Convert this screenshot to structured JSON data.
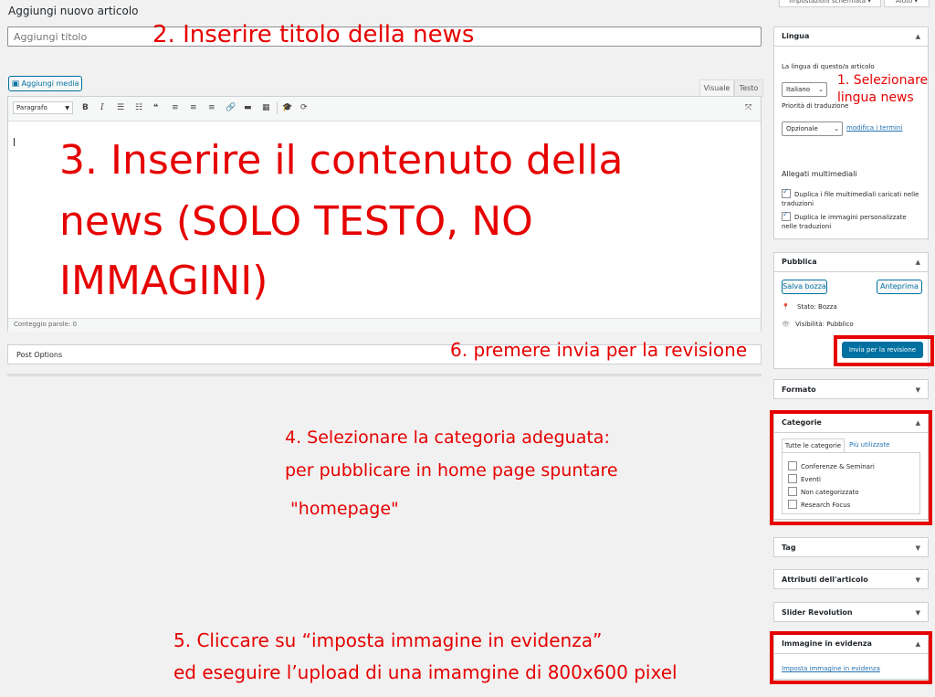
{
  "page": {
    "title": "Aggiungi nuovo articolo",
    "top_buttons": [
      "Impostazioni schermata ▾",
      "Aiuto ▾"
    ]
  },
  "title_input": {
    "placeholder": "Aggiungi titolo"
  },
  "editor": {
    "add_media_label": "Aggiungi media",
    "tabs": [
      "Visuale",
      "Testo"
    ],
    "format_select": "Paragrafo",
    "toolbar_icons": [
      "bold-icon",
      "italic-icon",
      "bullet-list-icon",
      "numbered-list-icon",
      "blockquote-icon",
      "align-left-icon",
      "align-center-icon",
      "align-right-icon",
      "link-icon",
      "read-more-icon",
      "toolbar-toggle-icon",
      "grad-cap-icon",
      "refresh-icon",
      "fullscreen-icon"
    ],
    "word_count": "Conteggio parole: 0"
  },
  "post_options": {
    "label": "Post Options"
  },
  "lingua_box": {
    "title": "Lingua",
    "language_label": "La lingua di questo/a articolo",
    "language_value": "Italiano",
    "priority_label": "Priorità di traduzione",
    "priority_value": "Opzionale",
    "edit_terms_link": "modifica i termini",
    "attachments_title": "Allegati multimediali",
    "check1": "Duplica i file multimediali caricati nelle traduzioni",
    "check2": "Duplica le immagini personalizzate nelle traduzioni"
  },
  "publish_box": {
    "title": "Pubblica",
    "save_draft": "Salva bozza",
    "preview": "Anteprima",
    "status": "Stato: Bozza",
    "visibility": "Visibilità: Pubblico",
    "submit": "Invia per la revisione"
  },
  "formato_box": {
    "title": "Formato"
  },
  "categorie_box": {
    "title": "Categorie",
    "tab_all": "Tutte le categorie",
    "tab_popular": "Più utilizzate",
    "items": [
      "Conferenze & Seminari",
      "Eventi",
      "Non categorizzato",
      "Research Focus"
    ]
  },
  "tag_box": {
    "title": "Tag"
  },
  "attributi_box": {
    "title": "Attributi dell'articolo"
  },
  "slider_box": {
    "title": "Slider Revolution"
  },
  "immagine_box": {
    "title": "Immagine in evidenza",
    "link": "Imposta immagine in evidenza"
  },
  "annotations": {
    "a1_line1": "1. Selezionare",
    "a1_line2": "lingua news",
    "a2": "2. Inserire titolo della news",
    "a3_line1": "3. Inserire il contenuto della",
    "a3_line2": "news (SOLO TESTO, NO",
    "a3_line3": "IMMAGINI)",
    "a4_line1": "4. Selezionare la categoria adeguata:",
    "a4_line2": "per pubblicare in home page spuntare",
    "a4_line3": "\"homepage\"",
    "a5_line1": "5. Cliccare su “imposta immagine in evidenza”",
    "a5_line2": "ed eseguire l’upload di una imamgine di 800x600 pixel",
    "a6": "6. premere invia per la revisione"
  },
  "colors": {
    "accent": "#2271b1",
    "annotation_red": "#e60000",
    "primary_button": "#0071a1"
  }
}
